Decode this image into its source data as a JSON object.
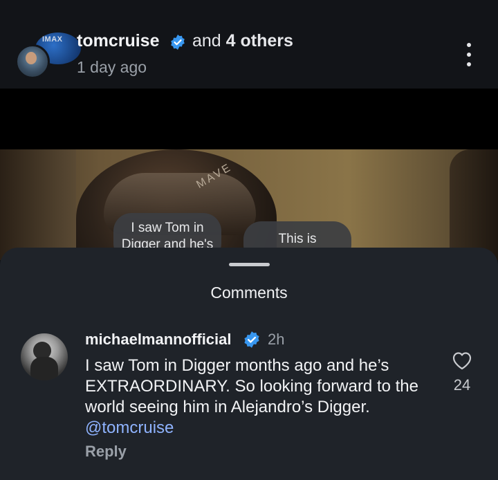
{
  "post": {
    "username": "tomcruise",
    "collaborators_prefix": "and",
    "collaborators_count": "4 others",
    "time_ago": "1 day ago",
    "imax_logo_text": "IMAX"
  },
  "media": {
    "helmet_text": "MAVE",
    "caption_bubbles": [
      "I saw Tom in Digger and he's",
      "This is"
    ]
  },
  "comments_sheet": {
    "title": "Comments",
    "comment": {
      "username": "michaelmannofficial",
      "time": "2h",
      "text": "I saw Tom in Digger months ago and he’s EXTRAORDINARY. So looking forward to the world seeing him in Alejandro’s Digger.",
      "mention": "@tomcruise",
      "reply_label": "Reply",
      "like_count": "24"
    }
  },
  "colors": {
    "verified": "#3897f0",
    "mention": "#8fb3ff",
    "sheet_bg": "#1f2329"
  }
}
